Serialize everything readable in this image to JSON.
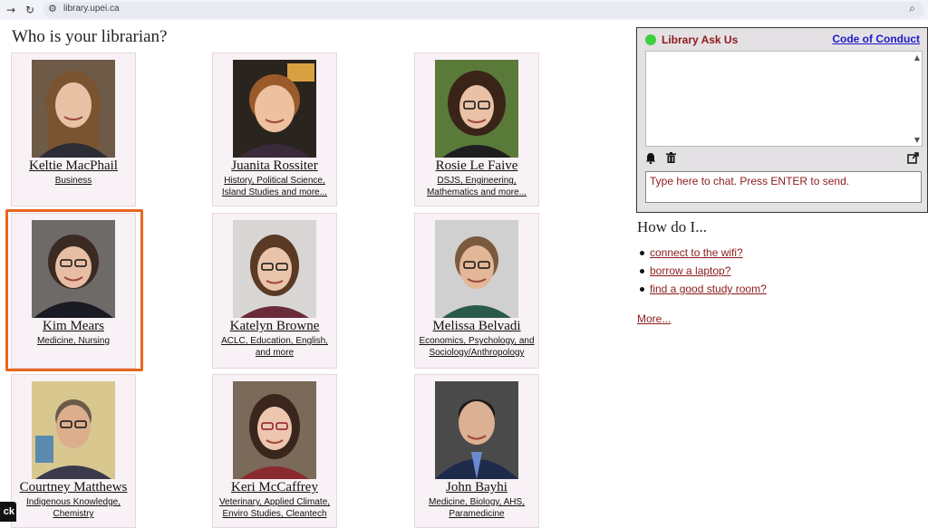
{
  "browser": {
    "url": "library.upei.ca",
    "icons": [
      "forward-arrow-icon",
      "reload-icon",
      "site-settings-icon",
      "zoom-icon"
    ]
  },
  "page": {
    "title": "Who is your librarian?"
  },
  "librarians": [
    {
      "name": "Keltie MacPhail",
      "subjects": [
        "Business"
      ],
      "bg": "#6d5a47",
      "skin": "#e8c2a4",
      "hair": "#7a5331",
      "top": "#2c2c34"
    },
    {
      "name": "Juanita Rossiter",
      "subjects": [
        "History, Political Science,",
        "Island Studies and more..."
      ],
      "bg": "#2a241e",
      "skin": "#eec0a0",
      "hair": "#9a5a2a",
      "top": "#3a2a3a"
    },
    {
      "name": "Rosie Le Faive",
      "subjects": [
        "DSJS, Engineering,",
        "Mathematics and more..."
      ],
      "bg": "#5a7a3a",
      "skin": "#e9c1a6",
      "hair": "#3a2418",
      "top": "#1e1e1e"
    },
    {
      "name": "Kim Mears",
      "subjects": [
        "Medicine, Nursing"
      ],
      "bg": "#6e6a68",
      "skin": "#e7bea4",
      "hair": "#3a2a22",
      "top": "#1a1a22"
    },
    {
      "name": "Katelyn Browne",
      "subjects": [
        "ACLC, Education, English,",
        "and more"
      ],
      "bg": "#d8d6d4",
      "skin": "#e9c4aa",
      "hair": "#5a3a24",
      "top": "#6a2a3a"
    },
    {
      "name": "Melissa Belvadi",
      "subjects": [
        "Economics, Psychology, and",
        "Sociology/Anthropology"
      ],
      "bg": "#d0d0d0",
      "skin": "#e2b697",
      "hair": "#7a5a3e",
      "top": "#2a5a4a"
    },
    {
      "name": "Courtney Matthews",
      "subjects": [
        "Indigenous Knowledge,",
        "Chemistry"
      ],
      "bg": "#d8c890",
      "skin": "#dcae8e",
      "hair": "#6a5a4a",
      "top": "#3a3a4a"
    },
    {
      "name": "Keri McCaffrey",
      "subjects": [
        "Veterinary, Applied Climate,",
        "Enviro Studies, Cleantech"
      ],
      "bg": "#7a6a5a",
      "skin": "#ecc6ae",
      "hair": "#3a261c",
      "top": "#8a2a2e"
    },
    {
      "name": "John Bayhi",
      "subjects": [
        "Medicine, Biology, AHS,",
        "Paramedicine"
      ],
      "bg": "#4a4a4a",
      "skin": "#dcb092",
      "hair": "#1e1a18",
      "top": "#1e2a4a"
    }
  ],
  "chat": {
    "title": "Library Ask Us",
    "code_of_conduct": "Code of Conduct",
    "placeholder": "Type here to chat. Press ENTER to send.",
    "status_color": "#3fcf3f",
    "icons": [
      "bell-icon",
      "trash-icon",
      "popout-icon"
    ]
  },
  "howdo": {
    "heading": "How do I...",
    "items": [
      "connect to the wifi?",
      "borrow a laptop?",
      "find a good study room?"
    ],
    "more": "More..."
  },
  "feedback_tab": "ck",
  "colors": {
    "highlight": "#e8661e",
    "link": "#8b1a1a",
    "card_bg": "#f8f1f5"
  }
}
